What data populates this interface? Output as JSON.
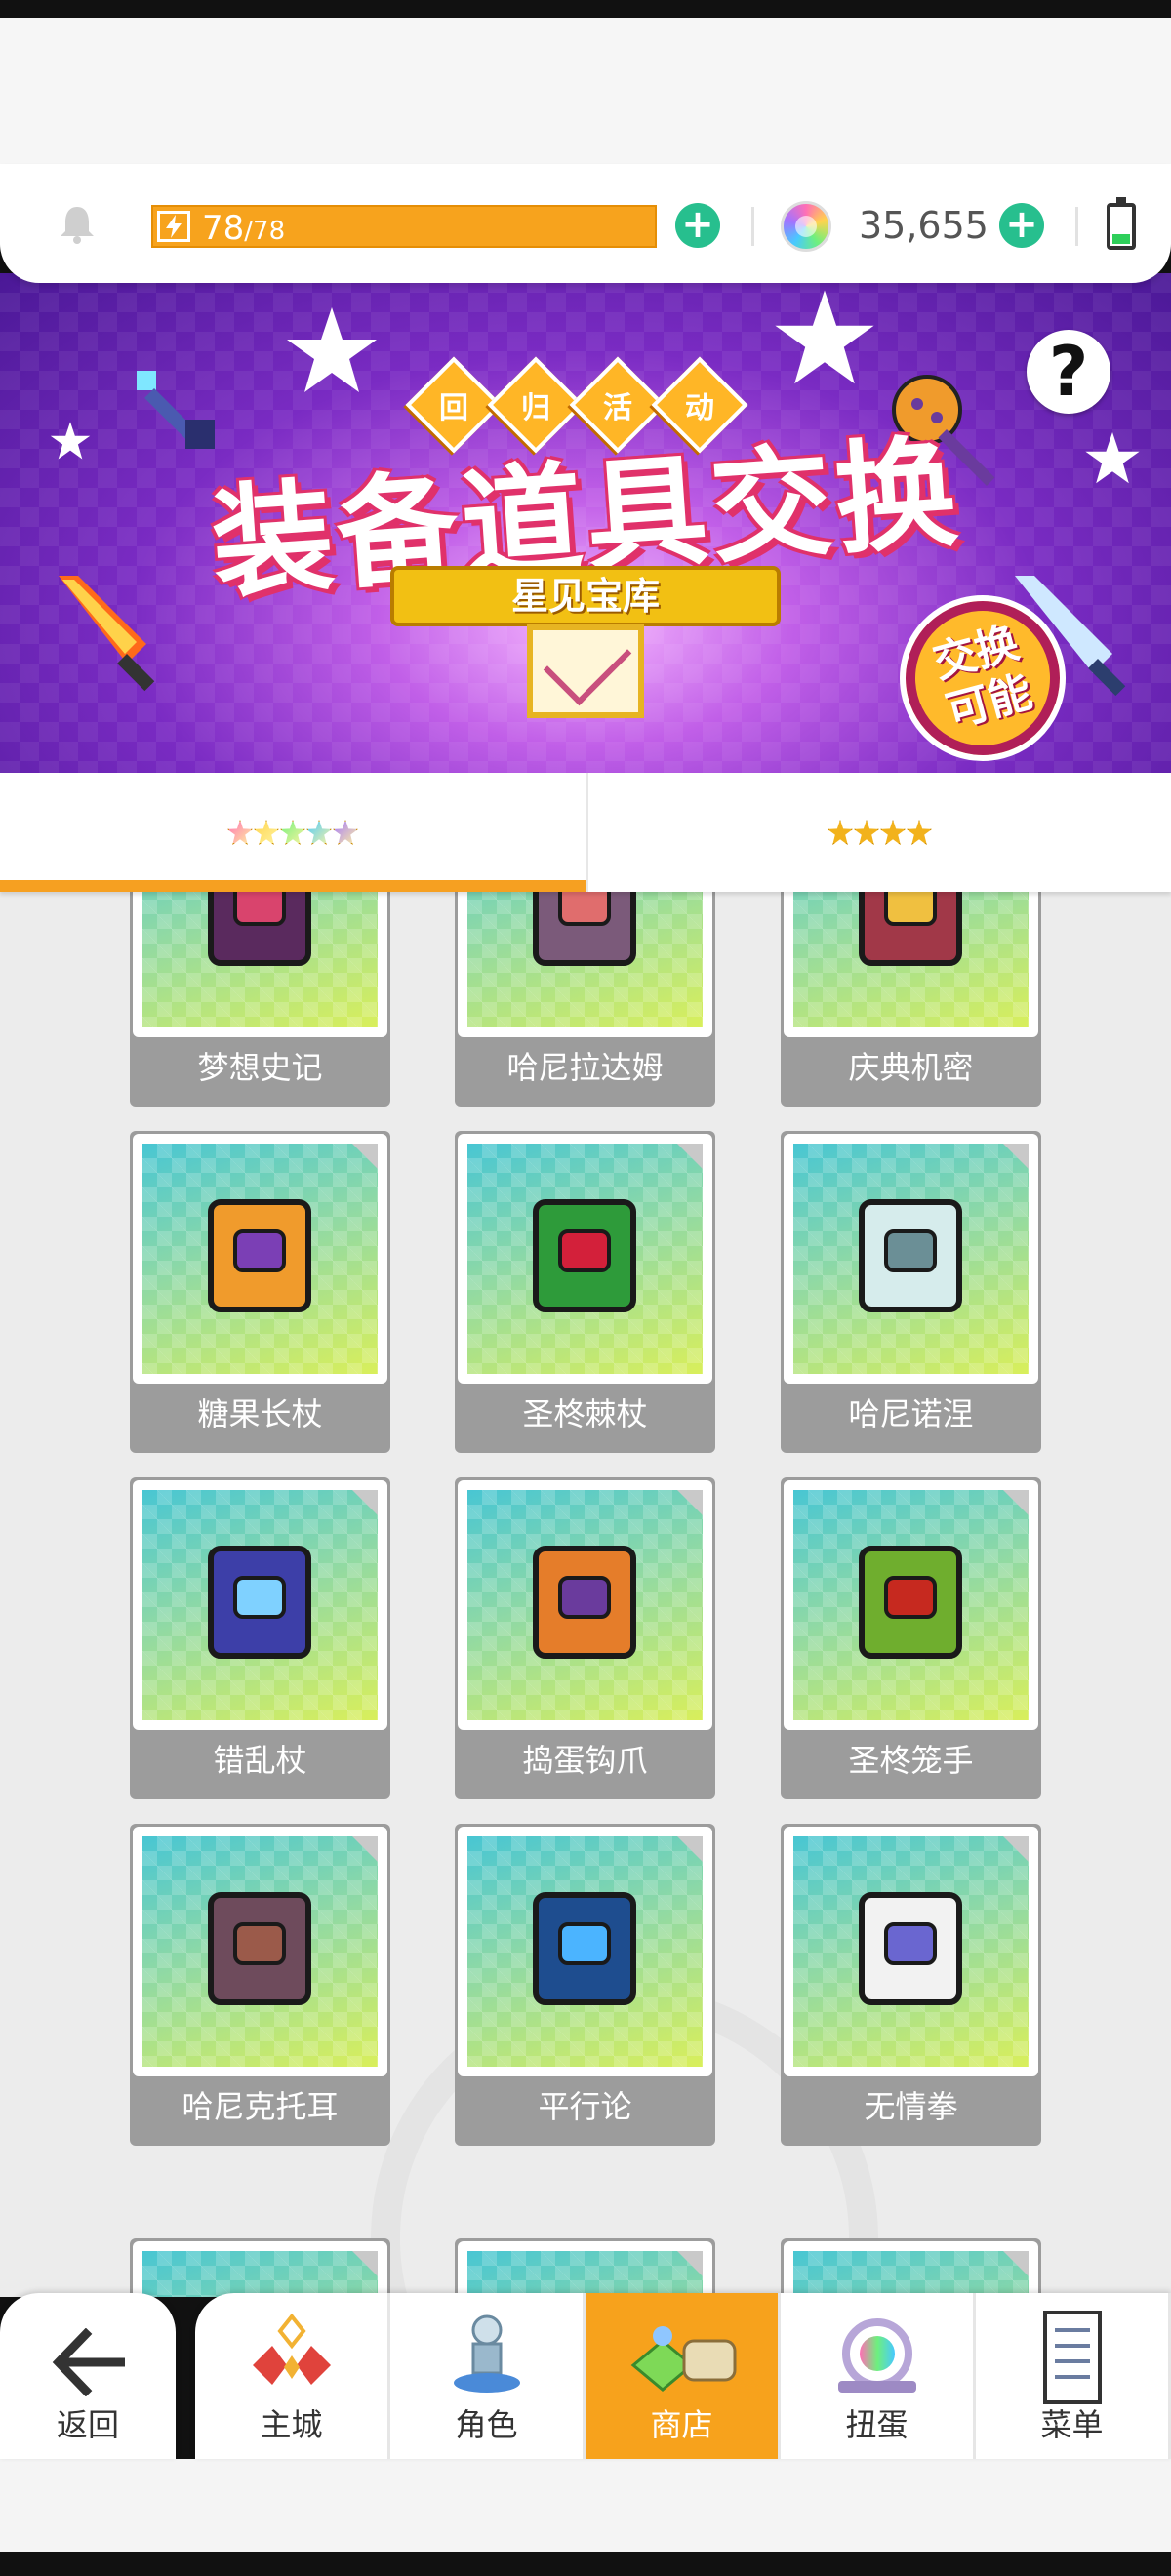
{
  "header": {
    "energy_current": "78",
    "energy_max": "/78",
    "energy_fraction": 1.0,
    "gems": "35,655"
  },
  "banner": {
    "badges": [
      "回",
      "归",
      "活",
      "动"
    ],
    "title": "装备道具交换",
    "ribbon": "星见宝库",
    "exchange_badge": "交换可能",
    "help": "?"
  },
  "tabs": [
    {
      "stars": 5,
      "rainbow": true,
      "active": true
    },
    {
      "stars": 4,
      "rainbow": false,
      "active": false
    }
  ],
  "items": [
    {
      "name": "梦想史记",
      "color": "#5a2a5e",
      "accent": "#d9446d"
    },
    {
      "name": "哈尼拉达姆",
      "color": "#7b5a7a",
      "accent": "#e06d6d"
    },
    {
      "name": "庆典机密",
      "color": "#a13848",
      "accent": "#f0c040"
    },
    {
      "name": "糖果长杖",
      "color": "#f09b2c",
      "accent": "#7b3fb5"
    },
    {
      "name": "圣柊棘杖",
      "color": "#2e9b3a",
      "accent": "#d3203a"
    },
    {
      "name": "哈尼诺涅",
      "color": "#d6ecec",
      "accent": "#6b8f96"
    },
    {
      "name": "错乱杖",
      "color": "#3d3fa8",
      "accent": "#7fd1ff"
    },
    {
      "name": "捣蛋钩爪",
      "color": "#e57d2a",
      "accent": "#6a3b9d"
    },
    {
      "name": "圣柊笼手",
      "color": "#6fae2e",
      "accent": "#c6291f"
    },
    {
      "name": "哈尼克托耳",
      "color": "#6e4b5c",
      "accent": "#9b5a4a"
    },
    {
      "name": "平行论",
      "color": "#1e4d8f",
      "accent": "#4bb4ff"
    },
    {
      "name": "无情拳",
      "color": "#f2f2f2",
      "accent": "#6a66d0"
    }
  ],
  "nav": {
    "back": "返回",
    "items": [
      {
        "label": "主城",
        "icon": "castle-icon",
        "active": false
      },
      {
        "label": "角色",
        "icon": "character-icon",
        "active": false
      },
      {
        "label": "商店",
        "icon": "shop-icon",
        "active": true
      },
      {
        "label": "扭蛋",
        "icon": "gacha-icon",
        "active": false
      },
      {
        "label": "菜单",
        "icon": "menu-icon",
        "active": false
      }
    ]
  },
  "colors": {
    "accent_orange": "#f7a21c",
    "plus_green": "#27bf8e",
    "card_gray": "#9c9c9c"
  }
}
